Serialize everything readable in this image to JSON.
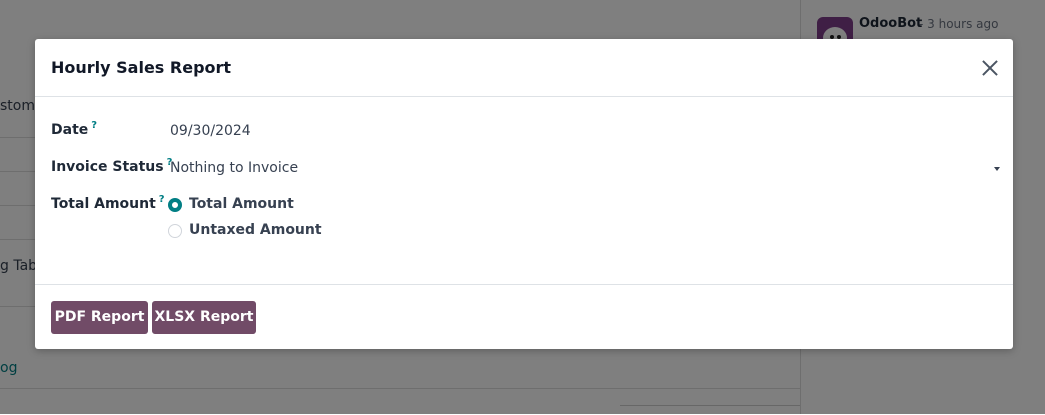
{
  "background": {
    "rows": [
      "stome",
      "g Tabl",
      "og"
    ],
    "chatter": {
      "author": "OdooBot",
      "time": "- 3 hours ago"
    }
  },
  "dialog": {
    "title": "Hourly Sales Report",
    "help_mark": "?",
    "fields": {
      "date": {
        "label": "Date",
        "value": "09/30/2024"
      },
      "invoice_status": {
        "label": "Invoice Status",
        "value": "Nothing to Invoice"
      },
      "total_amount": {
        "label": "Total Amount",
        "options": [
          "Total Amount",
          "Untaxed Amount"
        ],
        "selected": "Total Amount"
      }
    },
    "buttons": {
      "pdf": "PDF Report",
      "xlsx": "XLSX Report"
    }
  },
  "colors": {
    "primary": "#714b67",
    "accent": "#017e84",
    "backdrop": "#808080"
  }
}
